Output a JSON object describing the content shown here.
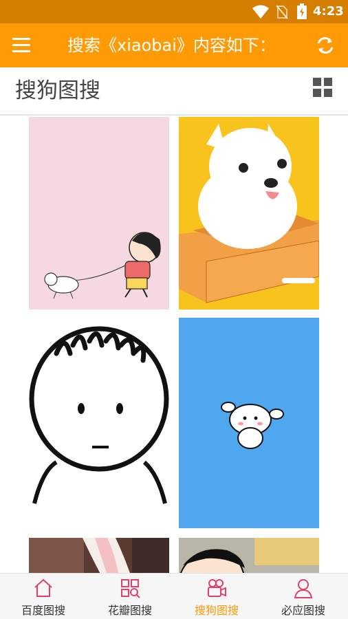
{
  "status_bar": {
    "time": "4:23"
  },
  "app_bar": {
    "title": "搜索《xiaobai》内容如下：",
    "menu_icon": "hamburger-menu-icon",
    "refresh_icon": "refresh-icon"
  },
  "section": {
    "title": "搜狗图搜",
    "view_icon": "grid-view-icon"
  },
  "images": [
    {
      "description": "pink wallpaper, boy walking white dog"
    },
    {
      "description": "white puppy in cardboard box on yellow"
    },
    {
      "description": "cartoon face line drawing"
    },
    {
      "description": "white dog cartoon on blue"
    },
    {
      "description": "rabbit ear photo"
    },
    {
      "description": "cartoon boy close-up"
    }
  ],
  "nav": {
    "items": [
      {
        "label": "百度图搜",
        "icon": "home-icon"
      },
      {
        "label": "花瓣图搜",
        "icon": "grid-search-icon"
      },
      {
        "label": "搜狗图搜",
        "icon": "camera-icon"
      },
      {
        "label": "必应图搜",
        "icon": "person-icon"
      }
    ],
    "active_index": 2
  },
  "colors": {
    "primary": "#fd9a05",
    "status_bar": "#d67e00",
    "accent_pink": "#e2406a"
  }
}
